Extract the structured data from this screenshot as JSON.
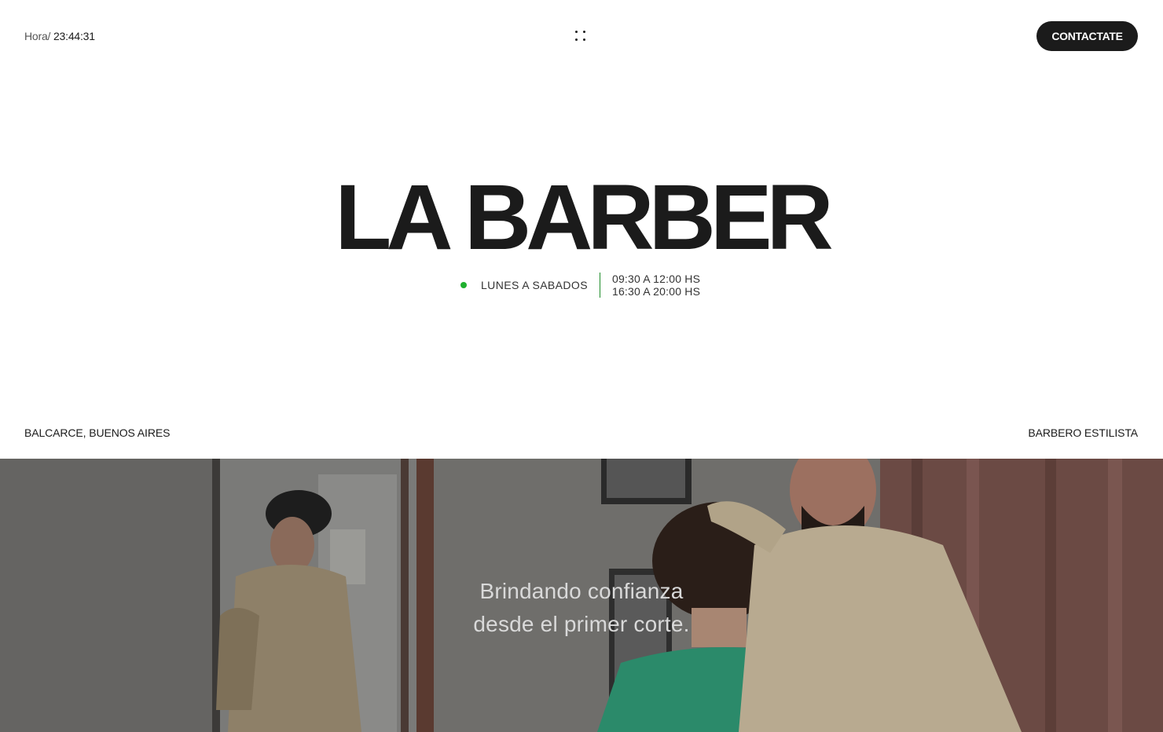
{
  "header": {
    "clock_label": "Hora/",
    "clock_time": "23:44:31",
    "menu_icon": "grid-dots-icon",
    "cta_label": "CONTACTATE"
  },
  "hero": {
    "title": "LA BARBER",
    "days": "LUNES A SABADOS",
    "hours_morning": "09:30 A 12:00 HS",
    "hours_afternoon": "16:30 A 20:00 HS",
    "status_color": "#1fb02e"
  },
  "footer_bar": {
    "location": "BALCARCE, BUENOS AIRES",
    "role": "BARBERO ESTILISTA"
  },
  "photo_section": {
    "tagline_line1": "Brindando confianza",
    "tagline_line2": "desde el primer corte."
  },
  "colors": {
    "text": "#1b1b1b",
    "accent": "#1b1b1b",
    "background": "#ffffff"
  }
}
